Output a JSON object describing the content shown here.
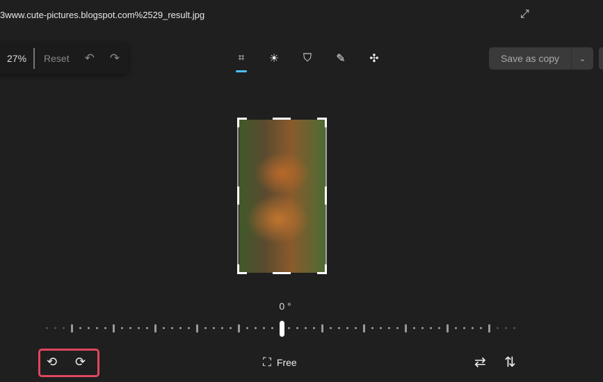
{
  "window": {
    "title": "3www.cute-pictures.blogspot.com%2529_result.jpg"
  },
  "zoom": {
    "value": "27%",
    "reset_label": "Reset"
  },
  "toolbar": {
    "tools": [
      "crop",
      "adjustment",
      "filter",
      "markup",
      "retouch"
    ],
    "active": "crop"
  },
  "save": {
    "label": "Save as copy"
  },
  "rotation": {
    "label": "0 °",
    "value": 0
  },
  "aspect": {
    "label": "Free"
  },
  "colors": {
    "accent": "#4cc2ff",
    "highlight": "#e0465f",
    "bg": "#1f1f1f"
  }
}
